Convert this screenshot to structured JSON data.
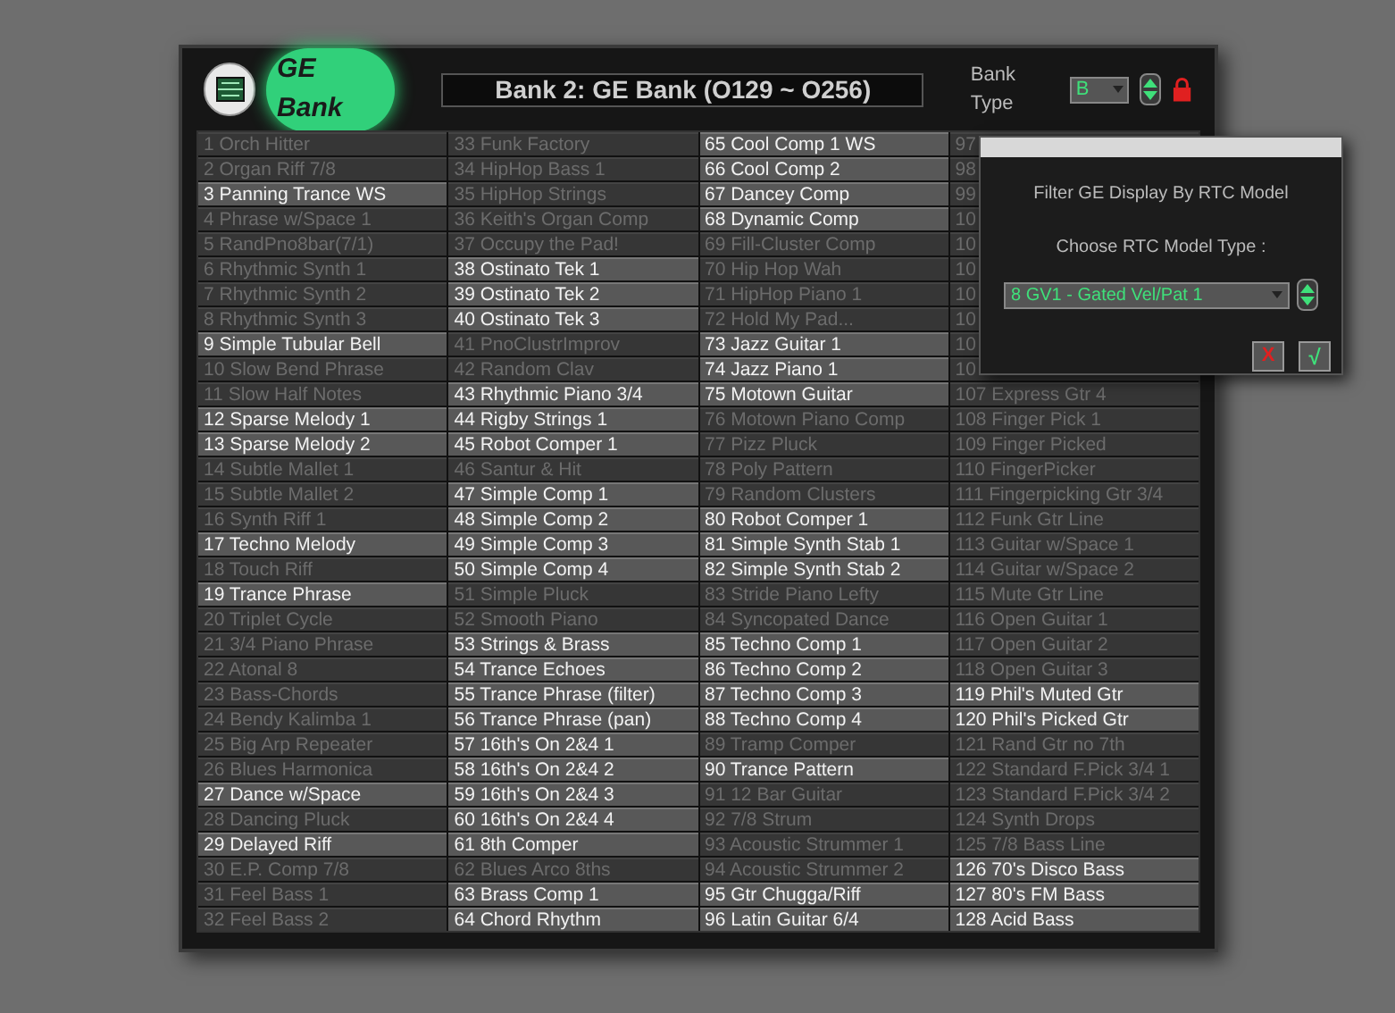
{
  "header": {
    "title": "GE Bank",
    "display": "Bank 2: GE Bank (O129 ~ O256)",
    "bank_type_label": "Bank Type",
    "bank_type_value": "B",
    "locked": true
  },
  "columns": [
    [
      {
        "label": "1 Orch Hitter",
        "enabled": false
      },
      {
        "label": "2 Organ Riff 7/8",
        "enabled": false
      },
      {
        "label": "3 Panning Trance WS",
        "enabled": true
      },
      {
        "label": "4 Phrase w/Space 1",
        "enabled": false
      },
      {
        "label": "5 RandPno8bar(7/1)",
        "enabled": false
      },
      {
        "label": "6 Rhythmic Synth 1",
        "enabled": false
      },
      {
        "label": "7 Rhythmic Synth 2",
        "enabled": false
      },
      {
        "label": "8 Rhythmic Synth 3",
        "enabled": false
      },
      {
        "label": "9 Simple Tubular Bell",
        "enabled": true
      },
      {
        "label": "10 Slow Bend Phrase",
        "enabled": false
      },
      {
        "label": "11 Slow Half Notes",
        "enabled": false
      },
      {
        "label": "12 Sparse Melody 1",
        "enabled": true
      },
      {
        "label": "13 Sparse Melody 2",
        "enabled": true
      },
      {
        "label": "14 Subtle Mallet 1",
        "enabled": false
      },
      {
        "label": "15 Subtle Mallet 2",
        "enabled": false
      },
      {
        "label": "16 Synth Riff 1",
        "enabled": false
      },
      {
        "label": "17 Techno Melody",
        "enabled": true
      },
      {
        "label": "18 Touch Riff",
        "enabled": false
      },
      {
        "label": "19 Trance Phrase",
        "enabled": true
      },
      {
        "label": "20 Triplet Cycle",
        "enabled": false
      },
      {
        "label": "21 3/4 Piano Phrase",
        "enabled": false
      },
      {
        "label": "22 Atonal 8",
        "enabled": false
      },
      {
        "label": "23 Bass-Chords",
        "enabled": false
      },
      {
        "label": "24 Bendy Kalimba 1",
        "enabled": false
      },
      {
        "label": "25 Big Arp Repeater",
        "enabled": false
      },
      {
        "label": "26 Blues Harmonica",
        "enabled": false
      },
      {
        "label": "27 Dance w/Space",
        "enabled": true
      },
      {
        "label": "28 Dancing Pluck",
        "enabled": false
      },
      {
        "label": "29 Delayed Riff",
        "enabled": true
      },
      {
        "label": "30 E.P. Comp 7/8",
        "enabled": false
      },
      {
        "label": "31 Feel Bass 1",
        "enabled": false
      },
      {
        "label": "32 Feel Bass 2",
        "enabled": false
      }
    ],
    [
      {
        "label": "33 Funk Factory",
        "enabled": false
      },
      {
        "label": "34 HipHop Bass 1",
        "enabled": false
      },
      {
        "label": "35 HipHop Strings",
        "enabled": false
      },
      {
        "label": "36 Keith's Organ Comp",
        "enabled": false
      },
      {
        "label": "37 Occupy the Pad!",
        "enabled": false
      },
      {
        "label": "38 Ostinato Tek 1",
        "enabled": true
      },
      {
        "label": "39 Ostinato Tek 2",
        "enabled": true
      },
      {
        "label": "40 Ostinato Tek 3",
        "enabled": true
      },
      {
        "label": "41 PnoClustrImprov",
        "enabled": false
      },
      {
        "label": "42 Random Clav",
        "enabled": false
      },
      {
        "label": "43 Rhythmic Piano 3/4",
        "enabled": true
      },
      {
        "label": "44 Rigby Strings 1",
        "enabled": true
      },
      {
        "label": "45 Robot Comper 1",
        "enabled": true
      },
      {
        "label": "46 Santur & Hit",
        "enabled": false
      },
      {
        "label": "47 Simple Comp 1",
        "enabled": true
      },
      {
        "label": "48 Simple Comp 2",
        "enabled": true
      },
      {
        "label": "49 Simple Comp 3",
        "enabled": true
      },
      {
        "label": "50 Simple Comp 4",
        "enabled": true
      },
      {
        "label": "51 Simple Pluck",
        "enabled": false
      },
      {
        "label": "52 Smooth Piano",
        "enabled": false
      },
      {
        "label": "53 Strings & Brass",
        "enabled": true
      },
      {
        "label": "54 Trance Echoes",
        "enabled": true
      },
      {
        "label": "55 Trance Phrase (filter)",
        "enabled": true
      },
      {
        "label": "56 Trance Phrase (pan)",
        "enabled": true
      },
      {
        "label": "57 16th's On 2&4 1",
        "enabled": true
      },
      {
        "label": "58 16th's On 2&4 2",
        "enabled": true
      },
      {
        "label": "59 16th's On 2&4 3",
        "enabled": true
      },
      {
        "label": "60 16th's On 2&4 4",
        "enabled": true
      },
      {
        "label": "61 8th Comper",
        "enabled": true
      },
      {
        "label": "62 Blues Arco 8ths",
        "enabled": false
      },
      {
        "label": "63 Brass Comp 1",
        "enabled": true
      },
      {
        "label": "64 Chord Rhythm",
        "enabled": true
      }
    ],
    [
      {
        "label": "65 Cool Comp 1 WS",
        "enabled": true
      },
      {
        "label": "66 Cool Comp 2",
        "enabled": true
      },
      {
        "label": "67 Dancey Comp",
        "enabled": true
      },
      {
        "label": "68 Dynamic Comp",
        "enabled": true
      },
      {
        "label": "69 Fill-Cluster Comp",
        "enabled": false
      },
      {
        "label": "70 Hip Hop Wah",
        "enabled": false
      },
      {
        "label": "71 HipHop Piano 1",
        "enabled": false
      },
      {
        "label": "72 Hold My Pad...",
        "enabled": false
      },
      {
        "label": "73 Jazz Guitar 1",
        "enabled": true
      },
      {
        "label": "74 Jazz Piano 1",
        "enabled": true
      },
      {
        "label": "75 Motown Guitar",
        "enabled": true
      },
      {
        "label": "76 Motown Piano Comp",
        "enabled": false
      },
      {
        "label": "77 Pizz Pluck",
        "enabled": false
      },
      {
        "label": "78 Poly Pattern",
        "enabled": false
      },
      {
        "label": "79 Random Clusters",
        "enabled": false
      },
      {
        "label": "80 Robot Comper 1",
        "enabled": true
      },
      {
        "label": "81 Simple Synth Stab 1",
        "enabled": true
      },
      {
        "label": "82 Simple Synth Stab 2",
        "enabled": true
      },
      {
        "label": "83 Stride Piano Lefty",
        "enabled": false
      },
      {
        "label": "84 Syncopated Dance",
        "enabled": false
      },
      {
        "label": "85 Techno Comp 1",
        "enabled": true
      },
      {
        "label": "86 Techno Comp 2",
        "enabled": true
      },
      {
        "label": "87 Techno Comp 3",
        "enabled": true
      },
      {
        "label": "88 Techno Comp 4",
        "enabled": true
      },
      {
        "label": "89 Tramp Comper",
        "enabled": false
      },
      {
        "label": "90 Trance Pattern",
        "enabled": true
      },
      {
        "label": "91 12 Bar Guitar",
        "enabled": false
      },
      {
        "label": "92 7/8 Strum",
        "enabled": false
      },
      {
        "label": "93 Acoustic Strummer 1",
        "enabled": false
      },
      {
        "label": "94 Acoustic Strummer 2",
        "enabled": false
      },
      {
        "label": "95 Gtr Chugga/Riff",
        "enabled": true
      },
      {
        "label": "96 Latin Guitar 6/4",
        "enabled": true
      }
    ],
    [
      {
        "label": "97",
        "enabled": false
      },
      {
        "label": "98",
        "enabled": false
      },
      {
        "label": "99",
        "enabled": false
      },
      {
        "label": "10",
        "enabled": false
      },
      {
        "label": "10",
        "enabled": false
      },
      {
        "label": "10",
        "enabled": false
      },
      {
        "label": "10",
        "enabled": false
      },
      {
        "label": "10",
        "enabled": false
      },
      {
        "label": "10",
        "enabled": false
      },
      {
        "label": "10",
        "enabled": false
      },
      {
        "label": "107 Express Gtr 4",
        "enabled": false
      },
      {
        "label": "108 Finger Pick 1",
        "enabled": false
      },
      {
        "label": "109 Finger Picked",
        "enabled": false
      },
      {
        "label": "110 FingerPicker",
        "enabled": false
      },
      {
        "label": "111 Fingerpicking Gtr 3/4",
        "enabled": false
      },
      {
        "label": "112 Funk Gtr Line",
        "enabled": false
      },
      {
        "label": "113 Guitar w/Space 1",
        "enabled": false
      },
      {
        "label": "114 Guitar w/Space 2",
        "enabled": false
      },
      {
        "label": "115 Mute Gtr Line",
        "enabled": false
      },
      {
        "label": "116 Open Guitar 1",
        "enabled": false
      },
      {
        "label": "117 Open Guitar 2",
        "enabled": false
      },
      {
        "label": "118 Open Guitar 3",
        "enabled": false
      },
      {
        "label": "119 Phil's Muted Gtr",
        "enabled": true
      },
      {
        "label": "120 Phil's Picked Gtr",
        "enabled": true
      },
      {
        "label": "121 Rand Gtr no 7th",
        "enabled": false
      },
      {
        "label": "122 Standard F.Pick 3/4 1",
        "enabled": false
      },
      {
        "label": "123 Standard F.Pick 3/4 2",
        "enabled": false
      },
      {
        "label": "124 Synth Drops",
        "enabled": false
      },
      {
        "label": "125 7/8 Bass Line",
        "enabled": false
      },
      {
        "label": "126 70's Disco Bass",
        "enabled": true
      },
      {
        "label": "127 80's FM Bass",
        "enabled": true
      },
      {
        "label": "128 Acid Bass",
        "enabled": true
      }
    ]
  ],
  "dialog": {
    "message": "Filter GE Display By RTC Model",
    "prompt": "Choose RTC Model Type :",
    "selection": "8 GV1 - Gated Vel/Pat 1",
    "cancel": "X",
    "ok": "√"
  }
}
